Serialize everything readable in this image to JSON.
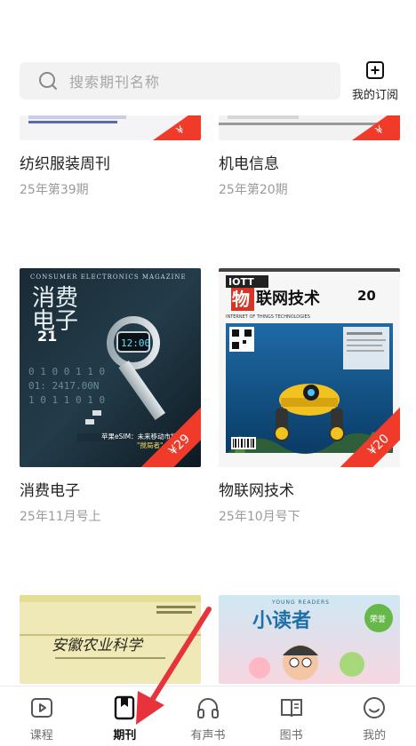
{
  "search": {
    "placeholder": "搜索期刊名称"
  },
  "subscription": {
    "label": "我的订阅",
    "icon": "add-bookmark-icon"
  },
  "magazines": [
    {
      "title": "纺织服装周刊",
      "issue": "25年第39期",
      "price": ""
    },
    {
      "title": "机电信息",
      "issue": "25年第20期",
      "price": ""
    },
    {
      "title": "消费电子",
      "issue": "25年11月号上",
      "price": "¥29",
      "cover_text": {
        "masthead": "消费电子",
        "header": "CONSUMER ELECTRONICS MAGAZINE",
        "issue_no": "21",
        "tagline": "苹果eSIM：未来移动市场的\"搅局\""
      }
    },
    {
      "title": "物联网技术",
      "issue": "25年10月号下",
      "price": "¥20",
      "cover_text": {
        "masthead": "联网技术",
        "logo": "IOTT",
        "sub": "INTERNET OF THINGS TECHNOLOGIES",
        "issue_no": "20"
      }
    },
    {
      "title": "",
      "issue": "",
      "price": "",
      "cover_text": {
        "masthead": "安徽农业科学"
      }
    },
    {
      "title": "",
      "issue": "",
      "price": "",
      "cover_text": {
        "masthead": "小读者",
        "header": "YOUNG READERS"
      }
    }
  ],
  "tabs": [
    {
      "label": "课程",
      "icon": "play-icon",
      "active": false
    },
    {
      "label": "期刊",
      "icon": "bookmark-icon",
      "active": true
    },
    {
      "label": "有声书",
      "icon": "headphones-icon",
      "active": false
    },
    {
      "label": "图书",
      "icon": "book-icon",
      "active": false
    },
    {
      "label": "我的",
      "icon": "smile-icon",
      "active": false
    }
  ],
  "colors": {
    "accent_red": "#f03a2a",
    "arrow": "#e8333c"
  }
}
